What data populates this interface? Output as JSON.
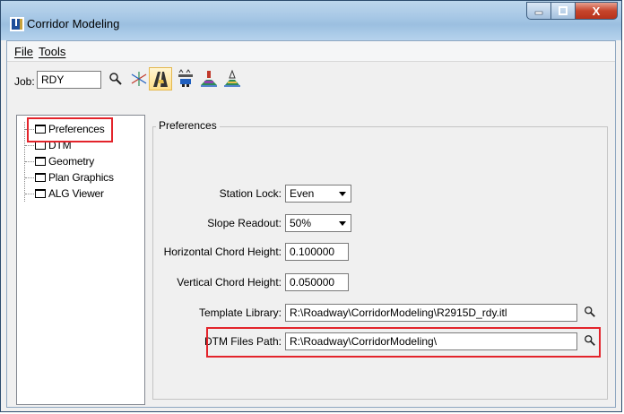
{
  "window": {
    "title": "Corridor Modeling",
    "close_glyph": "X",
    "close_color": "#c7452c",
    "highlight_color": "#e3242b"
  },
  "menu": {
    "file": "File",
    "tools": "Tools"
  },
  "toolbar": {
    "job_label": "Job:",
    "job_value": "RDY",
    "icons": [
      "search-icon",
      "axis-icon",
      "roadway-designer-icon",
      "drape-icon",
      "create-template-icon",
      "template-library-icon"
    ]
  },
  "tree": {
    "items": [
      {
        "label": "Preferences",
        "selected": true
      },
      {
        "label": "DTM"
      },
      {
        "label": "Geometry"
      },
      {
        "label": "Plan Graphics"
      },
      {
        "label": "ALG Viewer"
      }
    ]
  },
  "preferences": {
    "title": "Preferences",
    "station_lock": {
      "label": "Station Lock:",
      "value": "Even"
    },
    "slope_readout": {
      "label": "Slope Readout:",
      "value": "50%"
    },
    "horizontal_chord": {
      "label": "Horizontal Chord Height:",
      "value": "0.100000"
    },
    "vertical_chord": {
      "label": "Vertical Chord Height:",
      "value": "0.050000"
    },
    "template_library": {
      "label": "Template Library:",
      "value": "R:\\Roadway\\CorridorModeling\\R2915D_rdy.itl"
    },
    "dtm_files_path": {
      "label": "DTM Files Path:",
      "value": "R:\\Roadway\\CorridorModeling\\"
    }
  }
}
